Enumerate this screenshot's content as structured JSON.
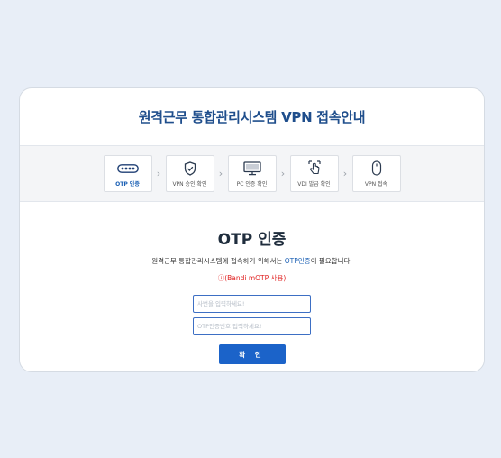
{
  "header": {
    "title": "원격근무 통합관리시스템 VPN 접속안내"
  },
  "steps": [
    {
      "label": "OTP 인증",
      "icon": "otp-key-icon",
      "active": true
    },
    {
      "label": "VPN 승인 확인",
      "icon": "shield-check-icon",
      "active": false
    },
    {
      "label": "PC 인증 확인",
      "icon": "monitor-icon",
      "active": false
    },
    {
      "label": "VDI 발급 확인",
      "icon": "touch-screen-icon",
      "active": false
    },
    {
      "label": "VPN 접속",
      "icon": "mouse-icon",
      "active": false
    }
  ],
  "step_arrow": "›",
  "main": {
    "title": "OTP 인증",
    "desc_before": "원격근무 통합관리시스템에 접속하기 위해서는 ",
    "desc_highlight": "OTP인증",
    "desc_after": "이 필요합니다.",
    "notice": "ⓘ(Bandi mOTP 사용)"
  },
  "form": {
    "id_placeholder": "사번을 입력하세요!",
    "otp_placeholder": "OTP인증번호 입력하세요!",
    "confirm_label": "확 인"
  },
  "colors": {
    "accent": "#1b63c9",
    "title": "#1f4e8c",
    "notice": "#e02020",
    "background": "#e8eef7"
  }
}
